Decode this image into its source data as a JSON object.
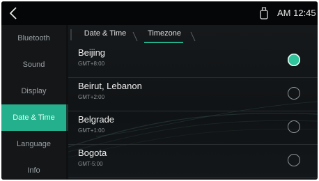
{
  "status": {
    "time": "AM 12:45",
    "back_icon": "chevron-left-icon",
    "usb_icon": "usb-icon"
  },
  "sidebar": {
    "items": [
      {
        "label": "Bluetooth",
        "active": false
      },
      {
        "label": "Sound",
        "active": false
      },
      {
        "label": "Display",
        "active": false
      },
      {
        "label": "Date & Time",
        "active": true
      },
      {
        "label": "Language",
        "active": false
      },
      {
        "label": "Info",
        "active": false
      }
    ]
  },
  "tabs": [
    {
      "label": "Date & Time",
      "active": false
    },
    {
      "label": "Timezone",
      "active": true
    }
  ],
  "timezones": [
    {
      "name": "Beijing",
      "offset": "GMT+8:00",
      "selected": true
    },
    {
      "name": "Beirut, Lebanon",
      "offset": "GMT+2:00",
      "selected": false
    },
    {
      "name": "Belgrade",
      "offset": "GMT+1:00",
      "selected": false
    },
    {
      "name": "Bogota",
      "offset": "GMT-5:00",
      "selected": false
    }
  ],
  "colors": {
    "accent": "#24b08c",
    "background": "#0e1012",
    "text": "#f0f0f0",
    "subtext": "#8a9094"
  }
}
